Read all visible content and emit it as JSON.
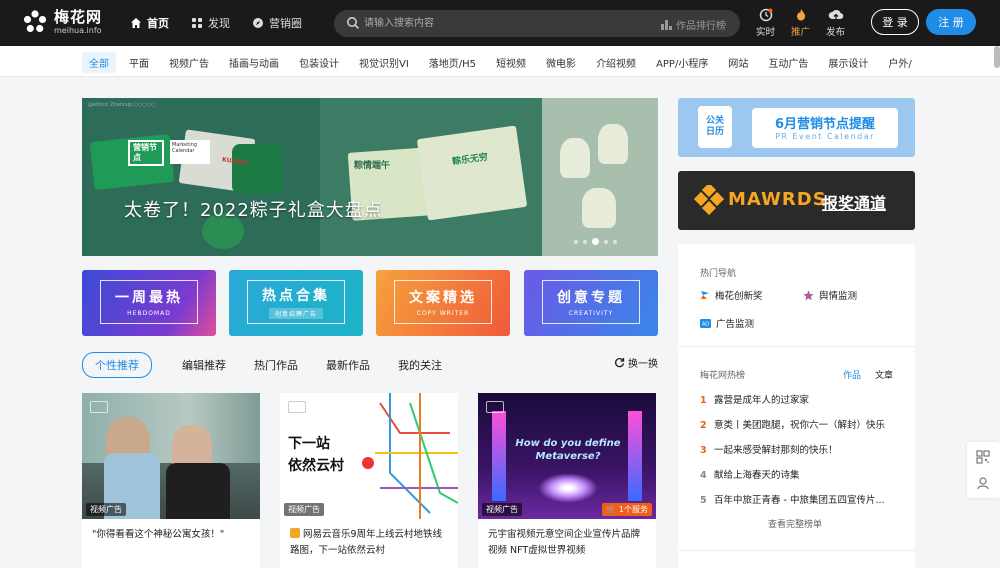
{
  "header": {
    "logo_cn": "梅花网",
    "logo_en": "meihua.info",
    "nav": [
      {
        "label": "首页",
        "icon": "home-icon",
        "active": true
      },
      {
        "label": "发现",
        "icon": "grid-icon",
        "active": false
      },
      {
        "label": "营销圈",
        "icon": "compass-icon",
        "active": false
      }
    ],
    "search": {
      "placeholder": "请输入搜索内容",
      "rank_label": "作品排行榜"
    },
    "tools": [
      {
        "label": "实时",
        "icon": "clock-icon"
      },
      {
        "label": "推广",
        "icon": "flame-icon"
      },
      {
        "label": "发布",
        "icon": "cloud-upload-icon"
      }
    ],
    "login_label": "登 录",
    "register_label": "注 册"
  },
  "categories": [
    "全部",
    "平面",
    "视频广告",
    "插画与动画",
    "包装设计",
    "视觉识别VI",
    "落地页/H5",
    "短视频",
    "微电影",
    "介绍视频",
    "APP/小程序",
    "网站",
    "互动广告",
    "展示设计",
    "户外/"
  ],
  "banner": {
    "title": "太卷了！2022粽子礼盒大盘点",
    "tag_text": "营销节点",
    "tag2_text": "Marketing Calendar",
    "small_text": "@ethnic  Zhencup  ○○○○○",
    "box_text_1": "粽情端午",
    "box_text_2": "粽乐无穷",
    "box_text_3": "KUAISH"
  },
  "quick_cards": [
    {
      "title": "一周最热",
      "sub": "HEBDOMAD"
    },
    {
      "title": "热点合集",
      "sub": "创意招聘广告"
    },
    {
      "title": "文案精选",
      "sub": "COPY WRITER"
    },
    {
      "title": "创意专题",
      "sub": "CREATIVITY"
    }
  ],
  "feed_tabs": [
    "个性推荐",
    "编辑推荐",
    "热门作品",
    "最新作品",
    "我的关注"
  ],
  "refresh_label": "换一换",
  "cards": [
    {
      "tag": "视频广告",
      "caption": "\"你得看看这个神秘公寓女孩！\"",
      "service": ""
    },
    {
      "tag": "视频广告",
      "caption": "网易云音乐9周年上线云村地铁线路图，下一站依然云村",
      "service": "",
      "poster_line1": "下一站",
      "poster_line2": "依然云村"
    },
    {
      "tag": "视频广告",
      "caption": "元宇宙视频元意空间企业宣传片品牌视频 NFT虚拟世界视频",
      "service": "1个服务",
      "poster_text": "How do you define Metaverse?"
    }
  ],
  "sidebar": {
    "ad1_title": "6月营销节点提醒",
    "ad1_sub": "PR Event Calendar",
    "ad1_badge_1": "公关",
    "ad1_badge_2": "日历",
    "ad2_brand": "MAWRDS",
    "ad2_title": "报奖通道",
    "hot_nav_title": "热门导航",
    "hot_nav": [
      {
        "label": "梅花创新奖",
        "icon": "flag-icon"
      },
      {
        "label": "舆情监测",
        "icon": "star-icon"
      },
      {
        "label": "广告监测",
        "icon": "ad-icon"
      }
    ],
    "hot_list_title": "梅花网热榜",
    "hot_tabs": [
      "作品",
      "文章"
    ],
    "hot_list": [
      {
        "rank": "1",
        "text": "露营是成年人的过家家"
      },
      {
        "rank": "2",
        "text": "意类丨美团跑腿，祝你六一（解封）快乐"
      },
      {
        "rank": "3",
        "text": "一起来感受解封那刻的快乐！"
      },
      {
        "rank": "4",
        "text": "献给上海春天的诗集"
      },
      {
        "rank": "5",
        "text": "百年中旅正青春 - 中旅集团五四宣传片..."
      }
    ],
    "more_label": "查看完整榜单"
  },
  "colors": {
    "brand_blue": "#1f8ce6",
    "hot_orange": "#f25d18",
    "topbar": "#1a1a1a"
  }
}
